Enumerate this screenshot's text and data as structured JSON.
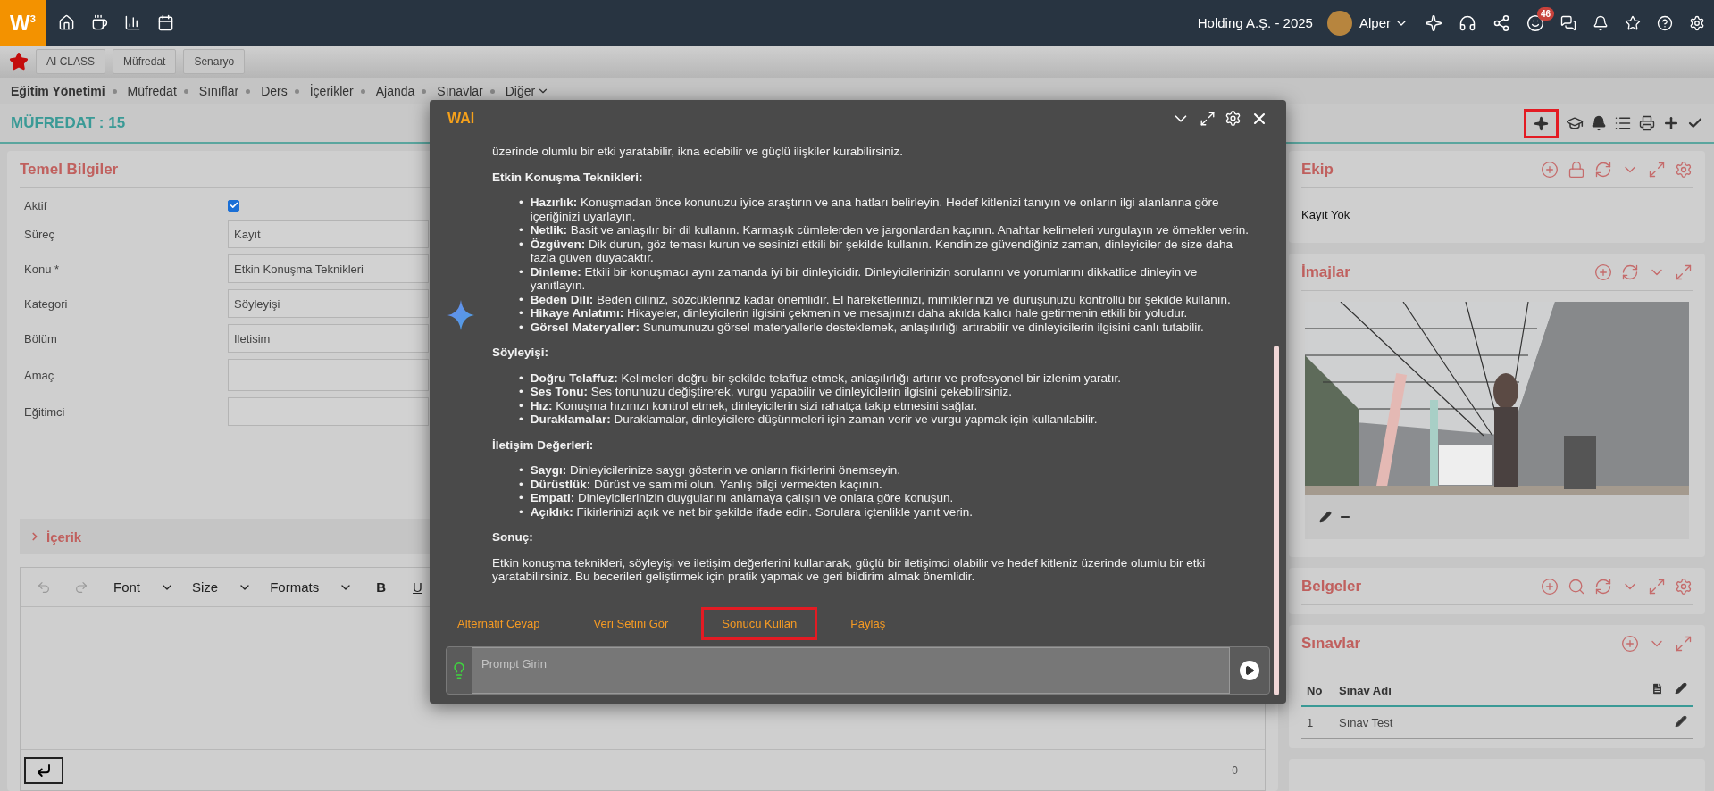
{
  "top_bar": {
    "logo": "W$^{3}$",
    "company": "Holding A.Ş. - 2025",
    "user": "Alper",
    "notification_count": "46"
  },
  "tabs": [
    {
      "label": "AI CLASS",
      "selected": false
    },
    {
      "label": "Müfredat",
      "selected": false
    },
    {
      "label": "Senaryo",
      "selected": false
    }
  ],
  "breadcrumb": {
    "root": "Eğitim Yönetimi",
    "items": [
      {
        "label": "Müfredat",
        "kind": "link"
      },
      {
        "label": "Sınıflar",
        "kind": "link"
      },
      {
        "label": "Ders",
        "kind": "link"
      },
      {
        "label": "İçerikler",
        "kind": "link"
      },
      {
        "label": "Ajanda",
        "kind": "link"
      },
      {
        "label": "Sınavlar",
        "kind": "link"
      },
      {
        "label": "Diğer",
        "kind": "menu"
      }
    ]
  },
  "page_title": "MÜFREDAT : 15",
  "toolbar": {
    "ai_highlighted": true
  },
  "form": {
    "title": "Temel Bilgiler",
    "rows": [
      {
        "label": "Aktif",
        "kind": "checkbox",
        "checked": true
      },
      {
        "label": "Süreç",
        "kind": "text",
        "value": "Kayıt"
      },
      {
        "label": "Konu *",
        "kind": "text",
        "value": "Etkin Konuşma Teknikleri"
      },
      {
        "label": "Kategori",
        "kind": "text",
        "value": "Söyleyişi"
      },
      {
        "label": "Bölüm",
        "kind": "text",
        "value": "Iletisim"
      },
      {
        "label": "Amaç",
        "kind": "text"
      },
      {
        "label": "Eğitimci",
        "kind": "text"
      }
    ]
  },
  "content_section": {
    "title": "İçerik",
    "expanded": false
  },
  "editor": {
    "toolbar": [
      "Font",
      "Size",
      "Formats"
    ],
    "bold": "B",
    "underline": "U",
    "counter": "0"
  },
  "side_panels": [
    {
      "kind": "team",
      "title": "Ekip",
      "empty_text": "Kayıt Yok"
    },
    {
      "kind": "images",
      "title": "İmajlar"
    },
    {
      "kind": "documents",
      "title": "Belgeler"
    },
    {
      "kind": "exams",
      "title": "Sınavlar",
      "columns": [
        "No",
        "Sınav Adı"
      ],
      "rows": [
        {
          "no": "1",
          "name": "Sınav Test"
        }
      ]
    }
  ],
  "modal": {
    "title": "WAI",
    "intro": "üzerinde olumlu bir etki yaratabilir, ikna edebilir ve güçlü ilişkiler kurabilirsiniz.",
    "sections": [
      {
        "heading": "Etkin Konuşma Teknikleri:",
        "bullets": [
          "**Hazırlık:** Konuşmadan önce konunuzu iyice araştırın ve ana hatları belirleyin. Hedef kitlenizi tanıyın ve onların ilgi alanlarına göre içeriğinizi uyarlayın.",
          "**Netlik:** Basit ve anlaşılır bir dil kullanın. Karmaşık cümlelerden ve jargonlardan kaçının. Anahtar kelimeleri vurgulayın ve örnekler verin.",
          "**Özgüven:** Dik durun, göz teması kurun ve sesinizi etkili bir şekilde kullanın. Kendinize güvendiğiniz zaman, dinleyiciler de size daha fazla güven duyacaktır.",
          "**Dinleme:** Etkili bir konuşmacı aynı zamanda iyi bir dinleyicidir. Dinleyicilerinizin sorularını ve yorumlarını dikkatlice dinleyin ve yanıtlayın.",
          "**Beden Dili:** Beden diliniz, sözcükleriniz kadar önemlidir. El hareketlerinizi, mimiklerinizi ve duruşunuzu kontrollü bir şekilde kullanın.",
          "**Hikaye Anlatımı:** Hikayeler, dinleyicilerin ilgisini çekmenin ve mesajınızı daha akılda kalıcı hale getirmenin etkili bir yoludur.",
          "**Görsel Materyaller:** Sunumunuzu görsel materyallerle desteklemek, anlaşılırlığı artırabilir ve dinleyicilerin ilgisini canlı tutabilir."
        ]
      },
      {
        "heading": "Söyleyişi:",
        "bullets": [
          "**Doğru Telaffuz:** Kelimeleri doğru bir şekilde telaffuz etmek, anlaşılırlığı artırır ve profesyonel bir izlenim yaratır.",
          "**Ses Tonu:** Ses tonunuzu değiştirerek, vurgu yapabilir ve dinleyicilerin ilgisini çekebilirsiniz.",
          "**Hız:** Konuşma hızınızı kontrol etmek, dinleyicilerin sizi rahatça takip etmesini sağlar.",
          "**Duraklamalar:** Duraklamalar, dinleyicilere düşünmeleri için zaman verir ve vurgu yapmak için kullanılabilir."
        ]
      },
      {
        "heading": "İletişim Değerleri:",
        "bullets": [
          "**Saygı:** Dinleyicilerinize saygı gösterin ve onların fikirlerini önemseyin.",
          "**Dürüstlük:** Dürüst ve samimi olun. Yanlış bilgi vermekten kaçının.",
          "**Empati:** Dinleyicilerinizin duygularını anlamaya çalışın ve onlara göre konuşun.",
          "**Açıklık:** Fikirlerinizi açık ve net bir şekilde ifade edin. Sorulara içtenlikle yanıt verin."
        ]
      },
      {
        "heading": "Sonuç:",
        "paragraph": "Etkin konuşma teknikleri, söyleyişi ve iletişim değerlerini kullanarak, güçlü bir iletişimci olabilir ve hedef kitleniz üzerinde olumlu bir etki yaratabilirsiniz. Bu becerileri geliştirmek için pratik yapmak ve geri bildirim almak önemlidir."
      }
    ],
    "actions": [
      {
        "label": "Alternatif Cevap",
        "highlighted": false
      },
      {
        "label": "Veri Setini Gör",
        "highlighted": false
      },
      {
        "label": "Sonucu Kullan",
        "highlighted": true
      },
      {
        "label": "Paylaş",
        "highlighted": false
      }
    ],
    "bullet_marker": "•",
    "prompt": {
      "placeholder": "Prompt Girin"
    }
  }
}
